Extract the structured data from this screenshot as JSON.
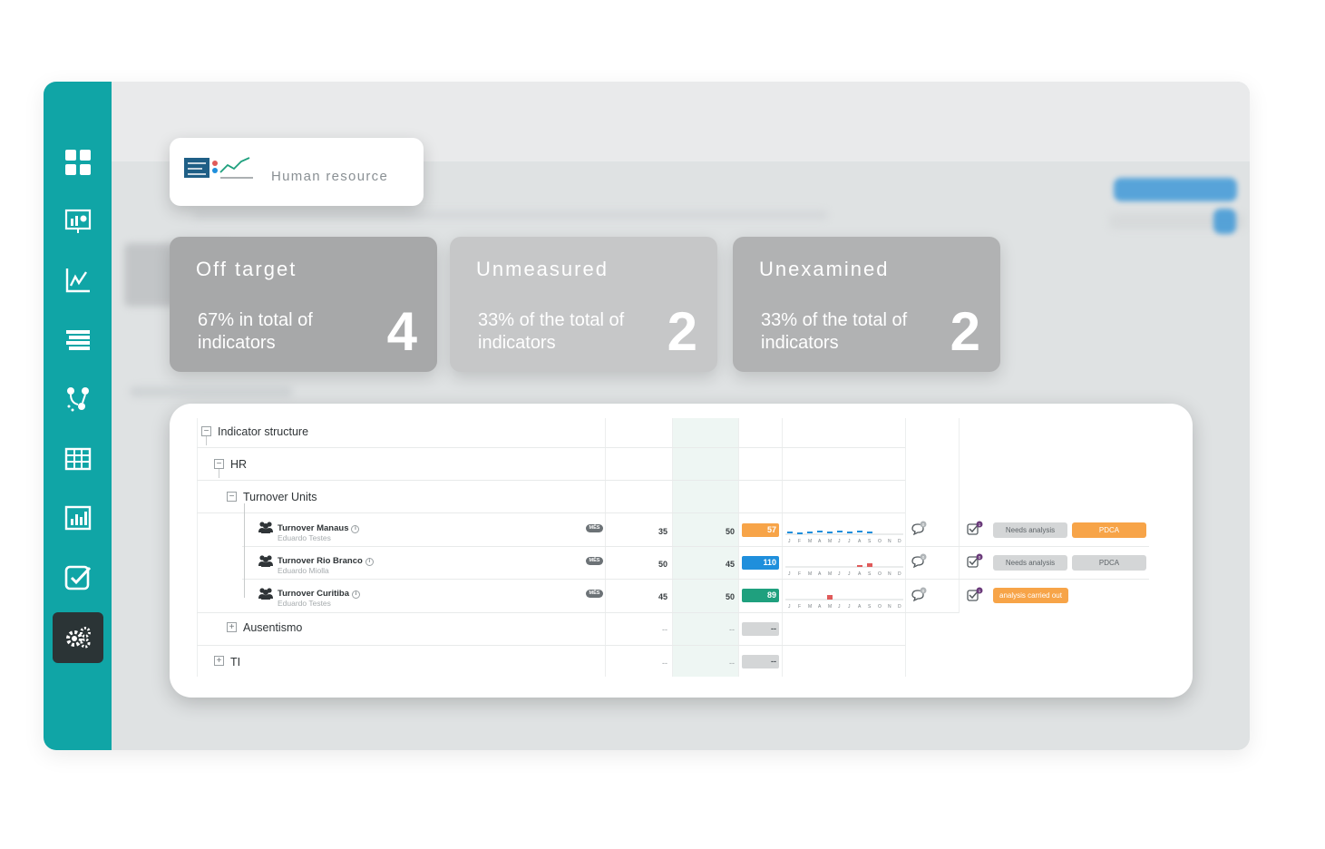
{
  "sidebar": {
    "items": [
      {
        "icon": "dashboard-grid-icon"
      },
      {
        "icon": "presentation-icon"
      },
      {
        "icon": "line-chart-icon"
      },
      {
        "icon": "list-icon"
      },
      {
        "icon": "workflow-icon"
      },
      {
        "icon": "table-icon"
      },
      {
        "icon": "bar-report-icon"
      },
      {
        "icon": "checklist-icon"
      },
      {
        "icon": "settings-gears-icon",
        "active": true
      }
    ]
  },
  "header_card": {
    "title": "Human resource"
  },
  "stats": [
    {
      "title": "Off target",
      "subtitle": "67% in total of indicators",
      "value": "4"
    },
    {
      "title": "Unmeasured",
      "subtitle": "33% of the total of indicators",
      "value": "2"
    },
    {
      "title": "Unexamined",
      "subtitle": "33% of the total of indicators",
      "value": "2"
    }
  ],
  "tree": {
    "root": "Indicator structure",
    "group": "HR",
    "subgroup": "Turnover Units",
    "indicators": [
      {
        "name": "Turnover Manaus",
        "owner": "Eduardo Testes",
        "period": "MÊS",
        "target": "35",
        "previous": "50",
        "result": "57",
        "result_color": "#f7a448",
        "months": [
          "J",
          "F",
          "M",
          "A",
          "M",
          "J",
          "J",
          "A",
          "S",
          "O",
          "N",
          "D"
        ],
        "comments": "0",
        "actions": "1",
        "status": "Needs analysis",
        "action_label": "PDCA",
        "action_color": "#f7a448"
      },
      {
        "name": "Turnover Rio Branco",
        "owner": "Eduardo Miolla",
        "period": "MÊS",
        "target": "50",
        "previous": "45",
        "result": "110",
        "result_color": "#1f8fdc",
        "months": [
          "J",
          "F",
          "M",
          "A",
          "M",
          "J",
          "J",
          "A",
          "S",
          "O",
          "N",
          "D"
        ],
        "comments": "0",
        "actions": "0",
        "status": "Needs analysis",
        "action_label": "PDCA",
        "action_color": "#d4d6d7"
      },
      {
        "name": "Turnover Curitiba",
        "owner": "Eduardo Testes",
        "period": "MÊS",
        "target": "45",
        "previous": "50",
        "result": "89",
        "result_color": "#1fa07e",
        "months": [
          "J",
          "F",
          "M",
          "A",
          "M",
          "J",
          "J",
          "A",
          "S",
          "O",
          "N",
          "D"
        ],
        "comments": "0",
        "actions": "1",
        "status": "analysis carried out"
      }
    ],
    "other_groups": [
      {
        "label": "Ausentismo",
        "target": "--",
        "previous": "--",
        "result": "--"
      },
      {
        "label": "TI",
        "target": "--",
        "previous": "--",
        "result": "--"
      }
    ]
  },
  "colors": {
    "accent": "#10a5a6",
    "orange": "#f7a448",
    "blue": "#1f8fdc",
    "green": "#1fa07e"
  }
}
